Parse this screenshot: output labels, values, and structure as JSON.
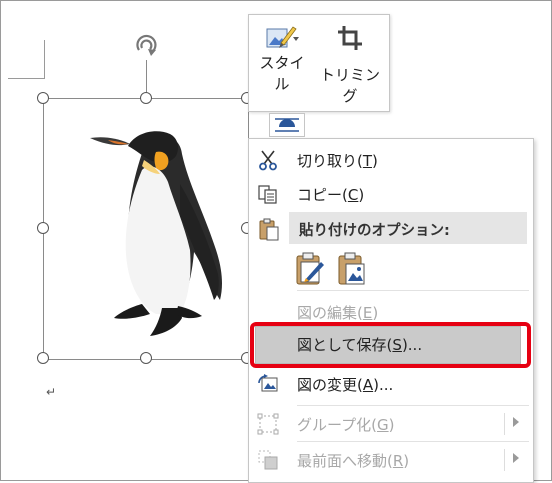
{
  "document": {
    "paragraph_mark": "↵",
    "image_alt": "penguin"
  },
  "picture_toolbar": {
    "style_button_label_line1": "スタイ",
    "style_button_label_line2": "ル",
    "crop_button_label": "トリミング"
  },
  "context_menu": {
    "items": [
      {
        "id": "cut",
        "label": "切り取り(T)",
        "prefix": "切り取り(",
        "key": "T",
        "suffix": ")",
        "enabled": true,
        "icon": "scissors-icon"
      },
      {
        "id": "copy",
        "label": "コピー(C)",
        "prefix": "コピー(",
        "key": "C",
        "suffix": ")",
        "enabled": true,
        "icon": "copy-icon"
      },
      {
        "id": "paste_header",
        "label": "貼り付けのオプション:",
        "icon": "clipboard-icon"
      },
      {
        "id": "edit_picture",
        "label": "図の編集(E)",
        "prefix": "図の編集(",
        "key": "E",
        "suffix": ")",
        "enabled": false
      },
      {
        "id": "save_as_picture",
        "label": "図として保存(S)...",
        "prefix": "図として保存(",
        "key": "S",
        "suffix": ")...",
        "enabled": true,
        "highlighted": true
      },
      {
        "id": "change_picture",
        "label": "図の変更(A)...",
        "prefix": "図の変更(",
        "key": "A",
        "suffix": ")...",
        "enabled": true,
        "icon": "change-picture-icon"
      },
      {
        "id": "group",
        "label": "グループ化(G)",
        "prefix": "グループ化(",
        "key": "G",
        "suffix": ")",
        "enabled": false,
        "icon": "group-icon",
        "submenu": true
      },
      {
        "id": "bring_to_front",
        "label": "最前面へ移動(R)",
        "prefix": "最前面へ移動(",
        "key": "R",
        "suffix": ")",
        "enabled": false,
        "icon": "bring-to-front-icon",
        "submenu": true
      }
    ],
    "paste_options": [
      "paste-keep-formatting-icon",
      "paste-picture-icon"
    ]
  },
  "colors": {
    "highlight_outline": "#e60012",
    "menu_hover": "#cacaca",
    "accent_blue": "#2b579a"
  }
}
